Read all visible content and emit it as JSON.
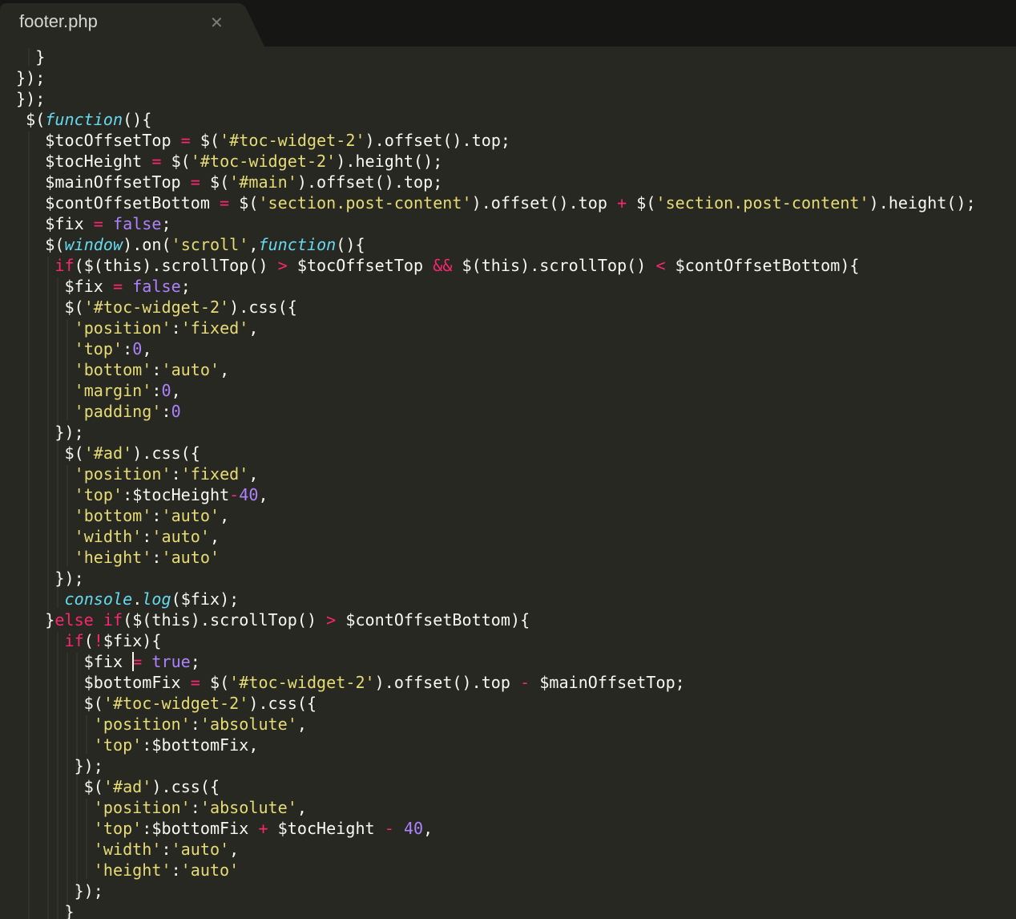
{
  "tab": {
    "title": "footer.php",
    "close_glyph": "✕"
  },
  "theme": {
    "background": "#272822",
    "tabbar": "#161714",
    "tab_active": "#272822",
    "keyword": "#f92672",
    "string": "#e6db74",
    "number": "#ae81ff",
    "function": "#66d9ef",
    "plain": "#f8f8f2"
  },
  "icons": {
    "tab_close": "close-icon"
  },
  "cursor": {
    "line": 29,
    "col": 6
  },
  "code_lines": [
    {
      "indent": 1,
      "tokens": [
        [
          "p",
          "  }"
        ]
      ]
    },
    {
      "indent": 0,
      "tokens": [
        [
          "p",
          "});"
        ]
      ]
    },
    {
      "indent": 0,
      "tokens": [
        [
          "p",
          "});"
        ]
      ]
    },
    {
      "indent": 0,
      "tokens": [
        [
          "p",
          " $("
        ],
        [
          "i",
          "function"
        ],
        [
          "p",
          "(){"
        ]
      ]
    },
    {
      "indent": 1,
      "tokens": [
        [
          "p",
          "   $tocOffsetTop "
        ],
        [
          "k",
          "="
        ],
        [
          "p",
          " $("
        ],
        [
          "s",
          "'#toc-widget-2'"
        ],
        [
          "p",
          ").offset().top;"
        ]
      ]
    },
    {
      "indent": 1,
      "tokens": [
        [
          "p",
          "   $tocHeight "
        ],
        [
          "k",
          "="
        ],
        [
          "p",
          " $("
        ],
        [
          "s",
          "'#toc-widget-2'"
        ],
        [
          "p",
          ").height();"
        ]
      ]
    },
    {
      "indent": 1,
      "tokens": [
        [
          "p",
          "   $mainOffsetTop "
        ],
        [
          "k",
          "="
        ],
        [
          "p",
          " $("
        ],
        [
          "s",
          "'#main'"
        ],
        [
          "p",
          ").offset().top;"
        ]
      ]
    },
    {
      "indent": 1,
      "tokens": [
        [
          "p",
          "   $contOffsetBottom "
        ],
        [
          "k",
          "="
        ],
        [
          "p",
          " $("
        ],
        [
          "s",
          "'section.post-content'"
        ],
        [
          "p",
          ").offset().top "
        ],
        [
          "k",
          "+"
        ],
        [
          "p",
          " $("
        ],
        [
          "s",
          "'section.post-content'"
        ],
        [
          "p",
          ").height();"
        ]
      ]
    },
    {
      "indent": 1,
      "tokens": [
        [
          "p",
          "   $fix "
        ],
        [
          "k",
          "="
        ],
        [
          "p",
          " "
        ],
        [
          "n",
          "false"
        ],
        [
          "p",
          ";"
        ]
      ]
    },
    {
      "indent": 1,
      "tokens": [
        [
          "p",
          "   $("
        ],
        [
          "i",
          "window"
        ],
        [
          "p",
          ").on("
        ],
        [
          "s",
          "'scroll'"
        ],
        [
          "p",
          ","
        ],
        [
          "i",
          "function"
        ],
        [
          "p",
          "(){"
        ]
      ]
    },
    {
      "indent": 2,
      "tokens": [
        [
          "p",
          "    "
        ],
        [
          "k",
          "if"
        ],
        [
          "p",
          "($(this).scrollTop() "
        ],
        [
          "k",
          ">"
        ],
        [
          "p",
          " $tocOffsetTop "
        ],
        [
          "k",
          "&&"
        ],
        [
          "p",
          " $(this).scrollTop() "
        ],
        [
          "k",
          "<"
        ],
        [
          "p",
          " $contOffsetBottom){"
        ]
      ]
    },
    {
      "indent": 3,
      "tokens": [
        [
          "p",
          "     $fix "
        ],
        [
          "k",
          "="
        ],
        [
          "p",
          " "
        ],
        [
          "n",
          "false"
        ],
        [
          "p",
          ";"
        ]
      ]
    },
    {
      "indent": 3,
      "tokens": [
        [
          "p",
          "     $("
        ],
        [
          "s",
          "'#toc-widget-2'"
        ],
        [
          "p",
          ").css({"
        ]
      ]
    },
    {
      "indent": 4,
      "tokens": [
        [
          "p",
          "      "
        ],
        [
          "s",
          "'position'"
        ],
        [
          "p",
          ":"
        ],
        [
          "s",
          "'fixed'"
        ],
        [
          "p",
          ","
        ]
      ]
    },
    {
      "indent": 4,
      "tokens": [
        [
          "p",
          "      "
        ],
        [
          "s",
          "'top'"
        ],
        [
          "p",
          ":"
        ],
        [
          "n",
          "0"
        ],
        [
          "p",
          ","
        ]
      ]
    },
    {
      "indent": 4,
      "tokens": [
        [
          "p",
          "      "
        ],
        [
          "s",
          "'bottom'"
        ],
        [
          "p",
          ":"
        ],
        [
          "s",
          "'auto'"
        ],
        [
          "p",
          ","
        ]
      ]
    },
    {
      "indent": 4,
      "tokens": [
        [
          "p",
          "      "
        ],
        [
          "s",
          "'margin'"
        ],
        [
          "p",
          ":"
        ],
        [
          "n",
          "0"
        ],
        [
          "p",
          ","
        ]
      ]
    },
    {
      "indent": 4,
      "tokens": [
        [
          "p",
          "      "
        ],
        [
          "s",
          "'padding'"
        ],
        [
          "p",
          ":"
        ],
        [
          "n",
          "0"
        ]
      ]
    },
    {
      "indent": 3,
      "tokens": [
        [
          "p",
          "    });"
        ]
      ]
    },
    {
      "indent": 3,
      "tokens": [
        [
          "p",
          "     $("
        ],
        [
          "s",
          "'#ad'"
        ],
        [
          "p",
          ").css({"
        ]
      ]
    },
    {
      "indent": 4,
      "tokens": [
        [
          "p",
          "      "
        ],
        [
          "s",
          "'position'"
        ],
        [
          "p",
          ":"
        ],
        [
          "s",
          "'fixed'"
        ],
        [
          "p",
          ","
        ]
      ]
    },
    {
      "indent": 4,
      "tokens": [
        [
          "p",
          "      "
        ],
        [
          "s",
          "'top'"
        ],
        [
          "p",
          ":$tocHeight"
        ],
        [
          "k",
          "-"
        ],
        [
          "n",
          "40"
        ],
        [
          "p",
          ","
        ]
      ]
    },
    {
      "indent": 4,
      "tokens": [
        [
          "p",
          "      "
        ],
        [
          "s",
          "'bottom'"
        ],
        [
          "p",
          ":"
        ],
        [
          "s",
          "'auto'"
        ],
        [
          "p",
          ","
        ]
      ]
    },
    {
      "indent": 4,
      "tokens": [
        [
          "p",
          "      "
        ],
        [
          "s",
          "'width'"
        ],
        [
          "p",
          ":"
        ],
        [
          "s",
          "'auto'"
        ],
        [
          "p",
          ","
        ]
      ]
    },
    {
      "indent": 4,
      "tokens": [
        [
          "p",
          "      "
        ],
        [
          "s",
          "'height'"
        ],
        [
          "p",
          ":"
        ],
        [
          "s",
          "'auto'"
        ]
      ]
    },
    {
      "indent": 3,
      "tokens": [
        [
          "p",
          "    });"
        ]
      ]
    },
    {
      "indent": 3,
      "tokens": [
        [
          "p",
          "     "
        ],
        [
          "i",
          "console"
        ],
        [
          "p",
          "."
        ],
        [
          "i",
          "log"
        ],
        [
          "p",
          "($fix);"
        ]
      ]
    },
    {
      "indent": 2,
      "tokens": [
        [
          "p",
          "   }"
        ],
        [
          "k",
          "else"
        ],
        [
          "p",
          " "
        ],
        [
          "k",
          "if"
        ],
        [
          "p",
          "($(this).scrollTop() "
        ],
        [
          "k",
          ">"
        ],
        [
          "p",
          " $contOffsetBottom){"
        ]
      ]
    },
    {
      "indent": 3,
      "tokens": [
        [
          "p",
          "     "
        ],
        [
          "k",
          "if"
        ],
        [
          "p",
          "("
        ],
        [
          "k",
          "!"
        ],
        [
          "p",
          "$fix){"
        ]
      ]
    },
    {
      "indent": 5,
      "tokens": [
        [
          "p",
          "       $fix "
        ],
        [
          "k",
          "="
        ],
        [
          "p",
          " "
        ],
        [
          "n",
          "true"
        ],
        [
          "p",
          ";"
        ]
      ]
    },
    {
      "indent": 5,
      "tokens": [
        [
          "p",
          "       $bottomFix "
        ],
        [
          "k",
          "="
        ],
        [
          "p",
          " $("
        ],
        [
          "s",
          "'#toc-widget-2'"
        ],
        [
          "p",
          ").offset().top "
        ],
        [
          "k",
          "-"
        ],
        [
          "p",
          " $mainOffsetTop;"
        ]
      ]
    },
    {
      "indent": 5,
      "tokens": [
        [
          "p",
          "       $("
        ],
        [
          "s",
          "'#toc-widget-2'"
        ],
        [
          "p",
          ").css({"
        ]
      ]
    },
    {
      "indent": 6,
      "tokens": [
        [
          "p",
          "        "
        ],
        [
          "s",
          "'position'"
        ],
        [
          "p",
          ":"
        ],
        [
          "s",
          "'absolute'"
        ],
        [
          "p",
          ","
        ]
      ]
    },
    {
      "indent": 6,
      "tokens": [
        [
          "p",
          "        "
        ],
        [
          "s",
          "'top'"
        ],
        [
          "p",
          ":$bottomFix,"
        ]
      ]
    },
    {
      "indent": 5,
      "tokens": [
        [
          "p",
          "      });"
        ]
      ]
    },
    {
      "indent": 5,
      "tokens": [
        [
          "p",
          "       $("
        ],
        [
          "s",
          "'#ad'"
        ],
        [
          "p",
          ").css({"
        ]
      ]
    },
    {
      "indent": 6,
      "tokens": [
        [
          "p",
          "        "
        ],
        [
          "s",
          "'position'"
        ],
        [
          "p",
          ":"
        ],
        [
          "s",
          "'absolute'"
        ],
        [
          "p",
          ","
        ]
      ]
    },
    {
      "indent": 6,
      "tokens": [
        [
          "p",
          "        "
        ],
        [
          "s",
          "'top'"
        ],
        [
          "p",
          ":$bottomFix "
        ],
        [
          "k",
          "+"
        ],
        [
          "p",
          " $tocHeight "
        ],
        [
          "k",
          "-"
        ],
        [
          "p",
          " "
        ],
        [
          "n",
          "40"
        ],
        [
          "p",
          ","
        ]
      ]
    },
    {
      "indent": 6,
      "tokens": [
        [
          "p",
          "        "
        ],
        [
          "s",
          "'width'"
        ],
        [
          "p",
          ":"
        ],
        [
          "s",
          "'auto'"
        ],
        [
          "p",
          ","
        ]
      ]
    },
    {
      "indent": 6,
      "tokens": [
        [
          "p",
          "        "
        ],
        [
          "s",
          "'height'"
        ],
        [
          "p",
          ":"
        ],
        [
          "s",
          "'auto'"
        ]
      ]
    },
    {
      "indent": 5,
      "tokens": [
        [
          "p",
          "      });"
        ]
      ]
    },
    {
      "indent": 4,
      "tokens": [
        [
          "p",
          "     }"
        ]
      ]
    }
  ]
}
